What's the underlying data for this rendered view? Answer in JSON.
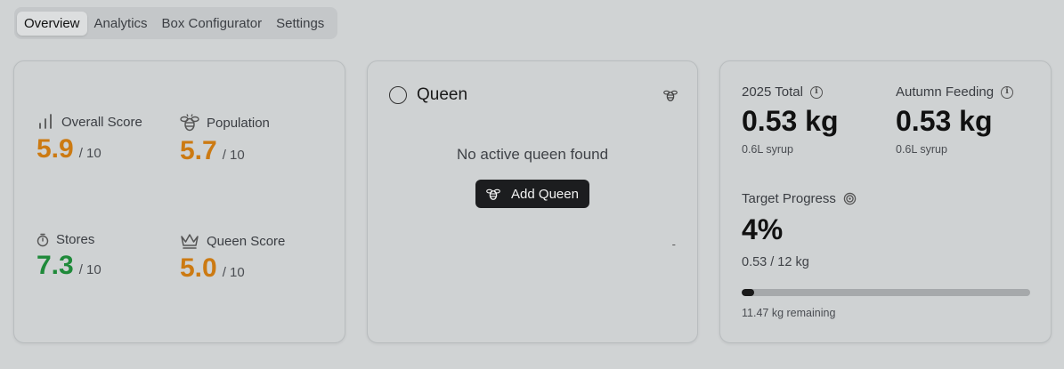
{
  "tabs": [
    {
      "label": "Overview",
      "active": true
    },
    {
      "label": "Analytics",
      "active": false
    },
    {
      "label": "Box Configurator",
      "active": false
    },
    {
      "label": "Settings",
      "active": false
    }
  ],
  "scores": {
    "overall": {
      "label": "Overall Score",
      "value": "5.9",
      "max": "/ 10",
      "color": "#cc7a12",
      "icon": "bar-chart-icon"
    },
    "population": {
      "label": "Population",
      "value": "5.7",
      "max": "/ 10",
      "color": "#cc7a12",
      "icon": "bee-icon"
    },
    "stores": {
      "label": "Stores",
      "value": "7.3",
      "max": "/ 10",
      "color": "#1f8a3a",
      "icon": "timer-icon"
    },
    "queen": {
      "label": "Queen Score",
      "value": "5.0",
      "max": "/ 10",
      "color": "#cc7a12",
      "icon": "crown-icon"
    }
  },
  "queen_card": {
    "title": "Queen",
    "empty_text": "No active queen found",
    "add_button": "Add Queen",
    "dash": "-"
  },
  "feeding": {
    "total": {
      "label": "2025 Total",
      "value": "0.53 kg",
      "sub": "0.6L syrup"
    },
    "autumn": {
      "label": "Autumn Feeding",
      "value": "0.53 kg",
      "sub": "0.6L syrup"
    },
    "target": {
      "label": "Target Progress",
      "percent": "4%",
      "ratio": "0.53 / 12 kg",
      "remaining": "11.47 kg remaining",
      "progress_fraction": 0.044
    }
  }
}
